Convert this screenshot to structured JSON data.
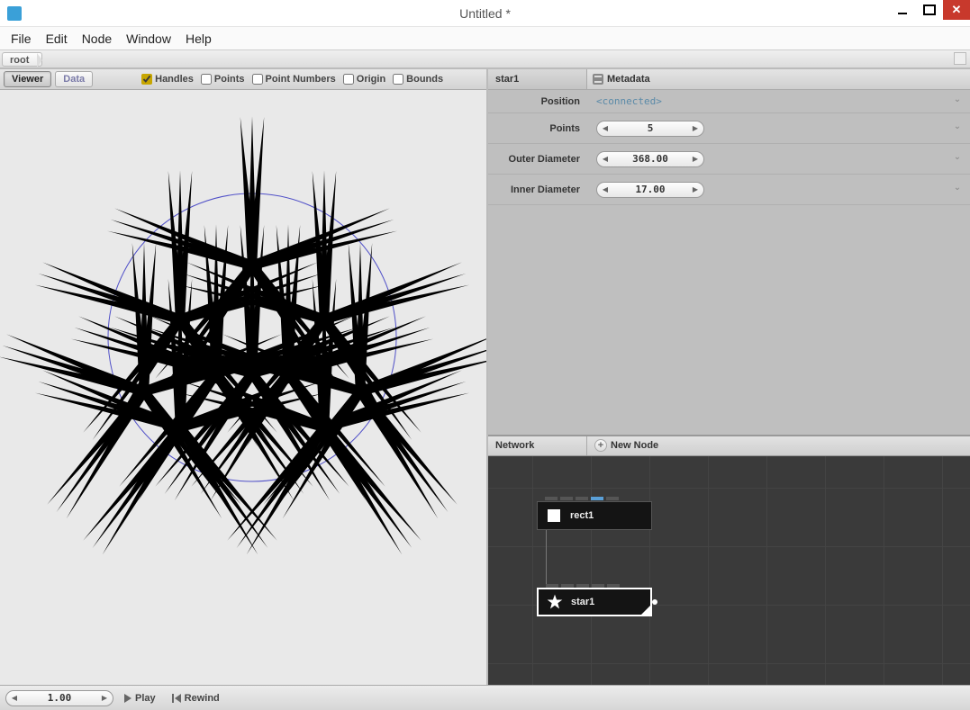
{
  "window": {
    "title": "Untitled *"
  },
  "menu": {
    "items": [
      "File",
      "Edit",
      "Node",
      "Window",
      "Help"
    ]
  },
  "breadcrumb": {
    "root": "root"
  },
  "viewer": {
    "tabs": {
      "viewer": "Viewer",
      "data": "Data"
    },
    "checks": {
      "handles": {
        "label": "Handles",
        "checked": true
      },
      "points": {
        "label": "Points",
        "checked": false
      },
      "point_numbers": {
        "label": "Point Numbers",
        "checked": false
      },
      "origin": {
        "label": "Origin",
        "checked": false
      },
      "bounds": {
        "label": "Bounds",
        "checked": false
      }
    }
  },
  "properties": {
    "selected_node": "star1",
    "metadata_tab": "Metadata",
    "rows": {
      "position": {
        "label": "Position",
        "value": "<connected>"
      },
      "points": {
        "label": "Points",
        "value": "5"
      },
      "outer_diameter": {
        "label": "Outer Diameter",
        "value": "368.00"
      },
      "inner_diameter": {
        "label": "Inner Diameter",
        "value": "17.00"
      }
    }
  },
  "network": {
    "label": "Network",
    "new_node": "New Node",
    "nodes": {
      "rect1": "rect1",
      "star1": "star1"
    }
  },
  "transport": {
    "frame": "1.00",
    "play": "Play",
    "rewind": "Rewind"
  }
}
